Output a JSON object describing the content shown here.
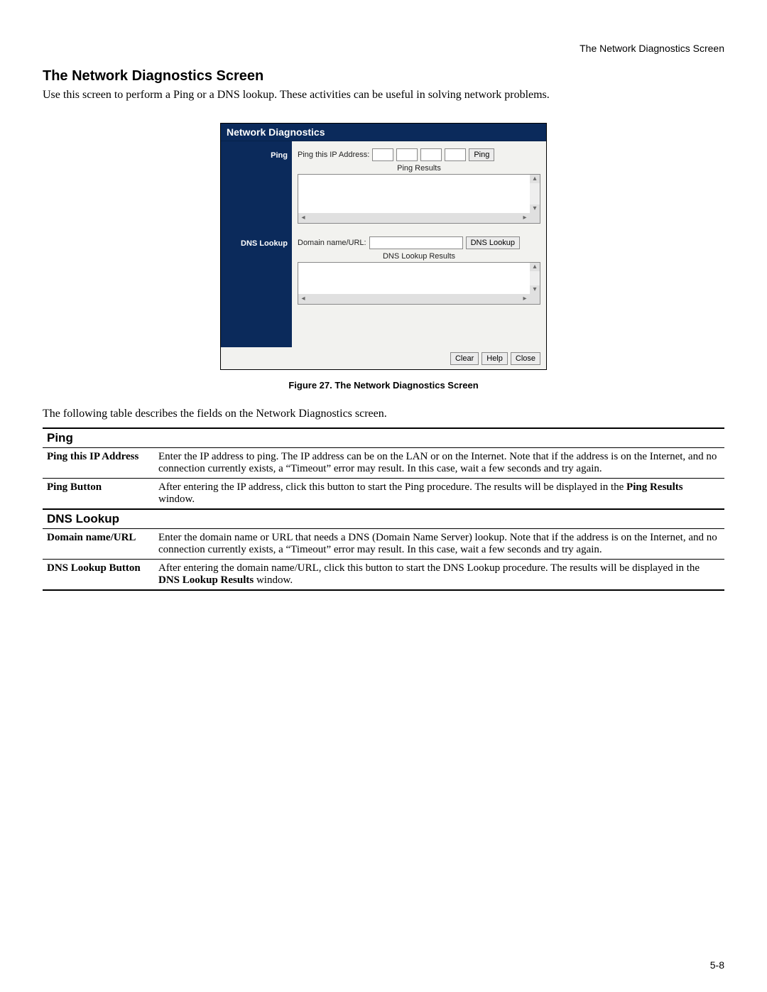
{
  "header_right": "The Network Diagnostics Screen",
  "title": "The Network Diagnostics Screen",
  "intro": "Use this screen to perform a Ping or a DNS lookup. These activities can be useful in solving network problems.",
  "figure": {
    "panel_title": "Network Diagnostics",
    "nav": {
      "ping": "Ping",
      "dns": "DNS Lookup"
    },
    "ping_section": {
      "label": "Ping this IP Address:",
      "button": "Ping",
      "results_title": "Ping Results"
    },
    "dns_section": {
      "label": "Domain name/URL:",
      "button": "DNS Lookup",
      "results_title": "DNS Lookup Results"
    },
    "footer": {
      "clear": "Clear",
      "help": "Help",
      "close": "Close"
    },
    "caption": "Figure 27. The Network Diagnostics Screen"
  },
  "lead2": "The following table describes the fields on the Network Diagnostics screen.",
  "table": {
    "section_ping": "Ping",
    "rows_ping": [
      {
        "k": "Ping this IP Address",
        "v_pre": "Enter the IP address to ping. The IP address can be on the LAN or on the Internet. Note that if the address is on the Internet, and no connection currently exists, a “Timeout” error may result. In this case, wait a few seconds and try again."
      },
      {
        "k": "Ping Button",
        "v_pre": "After entering the IP address, click this button to start the Ping procedure. The results will be displayed in the ",
        "v_bold": "Ping Results",
        "v_post": " window."
      }
    ],
    "section_dns": "DNS Lookup",
    "rows_dns": [
      {
        "k": "Domain name/URL",
        "v_pre": "Enter the domain name or URL that needs a DNS (Domain Name Server) lookup. Note that if the address is on the Internet, and no connection currently exists, a “Timeout” error may result. In this case, wait a few seconds and try again."
      },
      {
        "k": "DNS Lookup Button",
        "v_pre": "After entering the domain name/URL, click this button to start the DNS Lookup procedure. The results will be displayed in the ",
        "v_bold": "DNS Lookup Results",
        "v_post": " window."
      }
    ]
  },
  "page_num": "5-8"
}
